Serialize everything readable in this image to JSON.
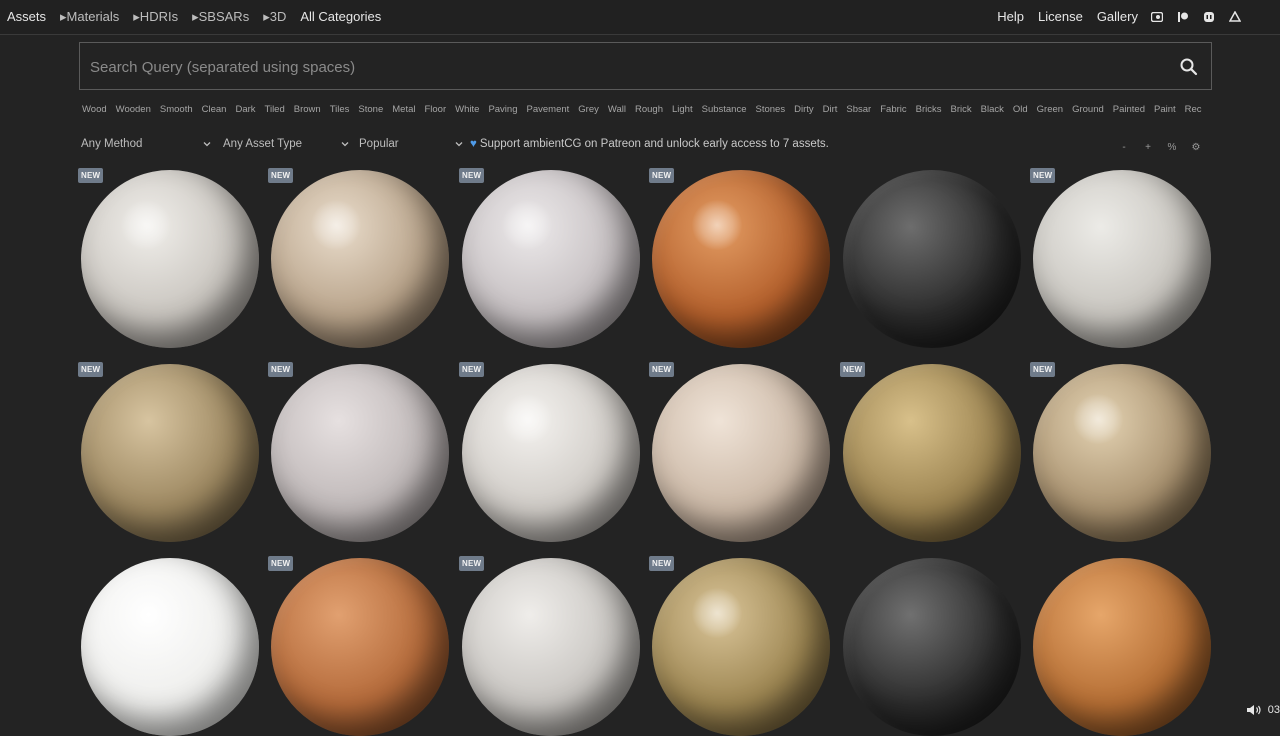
{
  "nav": {
    "left": [
      "Assets",
      "▸Materials",
      "▸HDRIs",
      "▸SBSARs",
      "▸3D",
      "All Categories"
    ],
    "right_links": [
      "Help",
      "License",
      "Gallery"
    ],
    "social_icons": [
      "patreon-square-icon",
      "patreon-icon",
      "mastodon-icon",
      "artstation-icon"
    ]
  },
  "search": {
    "placeholder": "Search Query (separated using spaces)",
    "value": "",
    "icon": "search-icon"
  },
  "tags": [
    "Wood",
    "Wooden",
    "Smooth",
    "Clean",
    "Dark",
    "Tiled",
    "Brown",
    "Tiles",
    "Stone",
    "Metal",
    "Floor",
    "White",
    "Paving",
    "Pavement",
    "Grey",
    "Wall",
    "Rough",
    "Light",
    "Substance",
    "Stones",
    "Dirty",
    "Dirt",
    "Sbsar",
    "Fabric",
    "Bricks",
    "Brick",
    "Black",
    "Old",
    "Green",
    "Ground",
    "Painted",
    "Paint",
    "Rec"
  ],
  "filters": {
    "method": "Any Method",
    "asset_type": "Any Asset Type",
    "sort": "Popular",
    "support_text": "Support ambientCG on Patreon and unlock early access to 7 assets.",
    "tools": [
      "-",
      "+",
      "%",
      "⚙"
    ]
  },
  "badge_label": "NEW",
  "assets": [
    {
      "new": true,
      "colors": [
        "#f0eeea",
        "#c9c5bf",
        "#8f8a85"
      ],
      "spec": true
    },
    {
      "new": true,
      "colors": [
        "#e9dccb",
        "#b8a38a",
        "#7a6650"
      ],
      "spec": true
    },
    {
      "new": true,
      "colors": [
        "#ece9ea",
        "#c5bfc1",
        "#8d8789"
      ],
      "spec": true
    },
    {
      "new": true,
      "colors": [
        "#e39c63",
        "#b4602c",
        "#6d3412"
      ],
      "spec": true
    },
    {
      "new": false,
      "colors": [
        "#6d6d6d",
        "#2b2b2b",
        "#101010"
      ],
      "spec": false
    },
    {
      "new": true,
      "colors": [
        "#ecebe7",
        "#c8c5bf",
        "#8c8984"
      ],
      "spec": false
    },
    {
      "new": true,
      "colors": [
        "#d7c4a0",
        "#9c8760",
        "#5e4f34"
      ],
      "spec": false
    },
    {
      "new": true,
      "colors": [
        "#e6e0e0",
        "#bfb8b8",
        "#857f7f"
      ],
      "spec": false
    },
    {
      "new": true,
      "colors": [
        "#f4f2ef",
        "#cfcbc6",
        "#8e8a86"
      ],
      "spec": true
    },
    {
      "new": true,
      "colors": [
        "#efe3d7",
        "#cbb8a6",
        "#8e7a69"
      ],
      "spec": false
    },
    {
      "new": true,
      "colors": [
        "#d8c08a",
        "#9b8350",
        "#5a4826"
      ],
      "spec": false
    },
    {
      "new": true,
      "colors": [
        "#e3d2b2",
        "#a99270",
        "#6b5638"
      ],
      "spec": true
    },
    {
      "new": false,
      "colors": [
        "#ffffff",
        "#eeeeec",
        "#c9c9c6"
      ],
      "spec": false
    },
    {
      "new": true,
      "colors": [
        "#e1a070",
        "#b46a3a",
        "#6e3c1c"
      ],
      "spec": false
    },
    {
      "new": true,
      "colors": [
        "#efedea",
        "#c8c5c1",
        "#8b8884"
      ],
      "spec": false
    },
    {
      "new": true,
      "colors": [
        "#d9c498",
        "#9d8652",
        "#5b4a2a"
      ],
      "spec": true
    },
    {
      "new": false,
      "colors": [
        "#707070",
        "#2c2c2c",
        "#101010"
      ],
      "spec": false
    },
    {
      "new": false,
      "colors": [
        "#e6a66a",
        "#b56e34",
        "#6e3f18"
      ],
      "spec": false
    }
  ],
  "player": {
    "time": "03"
  }
}
